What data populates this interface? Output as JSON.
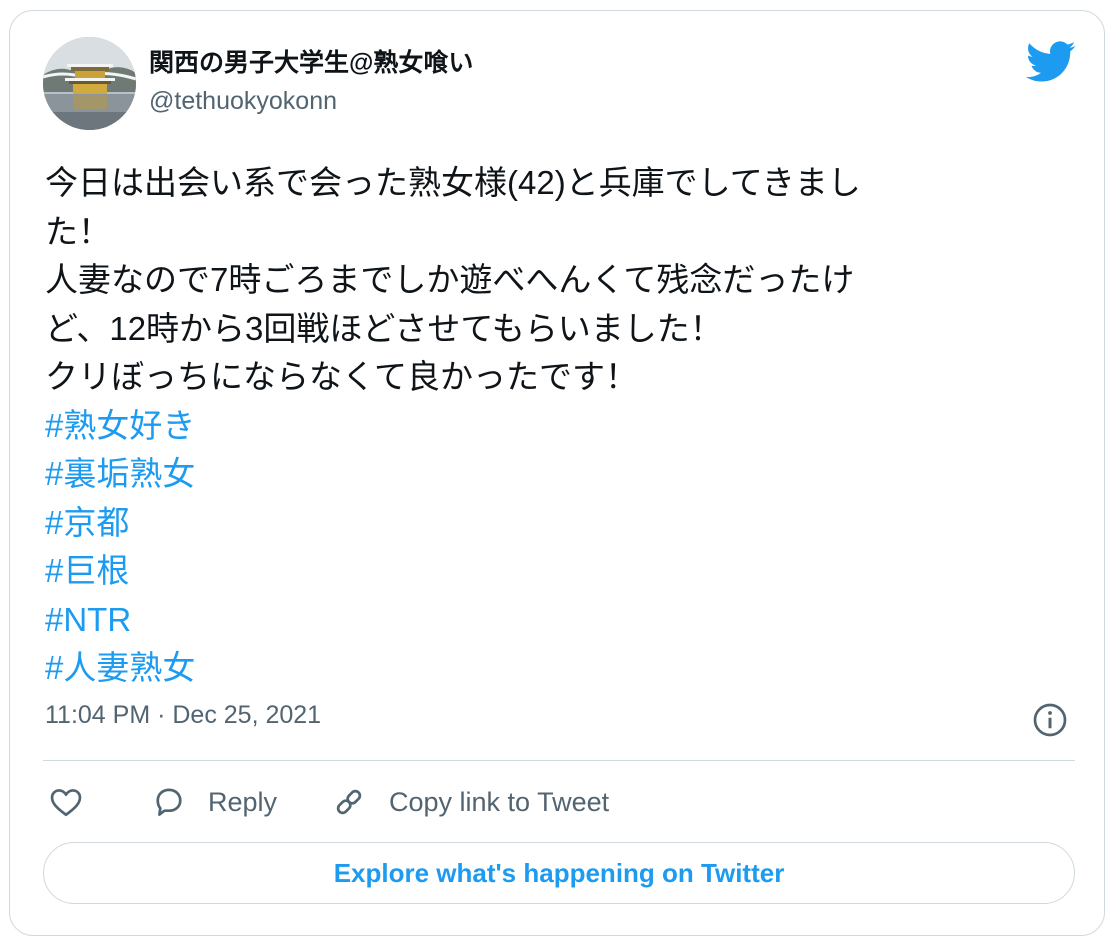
{
  "tweet": {
    "author": {
      "display_name": "関西の男子大学生@熟女喰い",
      "handle": "@tethuokyokonn",
      "avatar_icon": "avatar-golden-pavilion"
    },
    "brand_icon": "twitter-bird-icon",
    "text_lines": [
      "今日は出会い系で会った熟女様(42)と兵庫でしてきまし",
      "た！",
      "人妻なので7時ごろまでしか遊べへんくて残念だったけ",
      "ど、12時から3回戦ほどさせてもらいました！",
      "クリぼっちにならなくて良かったです！"
    ],
    "hashtags": [
      "#熟女好き",
      "#裏垢熟女",
      "#京都",
      "#巨根",
      "#NTR",
      "#人妻熟女"
    ],
    "timestamp": "11:04 PM · Dec 25, 2021",
    "info_icon": "info-icon"
  },
  "actions": {
    "like_icon": "heart-icon",
    "reply_icon": "comment-icon",
    "reply_label": "Reply",
    "copy_icon": "link-icon",
    "copy_label": "Copy link to Tweet"
  },
  "explore_label": "Explore what's happening on Twitter",
  "colors": {
    "accent": "#1d9bf0",
    "text": "#0f1419",
    "secondary": "#536471",
    "border": "#cfd9de"
  }
}
